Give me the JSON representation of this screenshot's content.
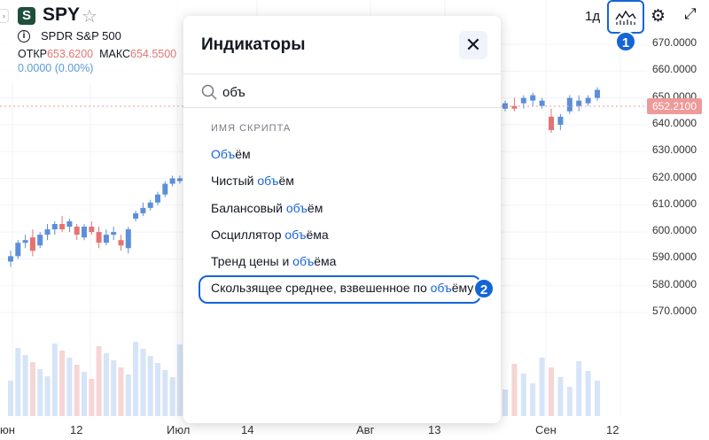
{
  "header": {
    "ticker": "SPY",
    "full_name": "SPDR S&P 500",
    "open_label": "ОТКР",
    "open_value": "653.6200",
    "high_label": "МАКС",
    "high_value": "654.5500",
    "change": "0.0000 (0.00%)"
  },
  "toolbar": {
    "timeframe": "1д",
    "indicators_icon": "indicators-icon",
    "settings_icon": "gear-icon",
    "expand_icon": "expand-icon"
  },
  "annotations": {
    "badge_1": "1",
    "badge_2": "2"
  },
  "modal": {
    "title": "Индикаторы",
    "search_value": "объ",
    "section_label": "ИМЯ СКРИПТА",
    "items": [
      {
        "pre": "",
        "hl": "Объ",
        "post": "ём"
      },
      {
        "pre": "Чистый ",
        "hl": "объ",
        "post": "ём"
      },
      {
        "pre": "Балансовый ",
        "hl": "объ",
        "post": "ём"
      },
      {
        "pre": "Осциллятор ",
        "hl": "объ",
        "post": "ёма"
      },
      {
        "pre": "Тренд цены и ",
        "hl": "объ",
        "post": "ёма"
      },
      {
        "pre": "Скользящее среднее, взвешенное по ",
        "hl": "объ",
        "post": "ёму"
      }
    ]
  },
  "price_axis": {
    "labels": [
      "670.0000",
      "660.0000",
      "650.0000",
      "640.0000",
      "630.0000",
      "620.0000",
      "610.0000",
      "600.0000",
      "590.0000",
      "580.0000",
      "570.0000"
    ],
    "current_price": "652.2100"
  },
  "time_axis": {
    "labels": [
      "юн",
      "12",
      "Июл",
      "14",
      "Авг",
      "13",
      "Сен",
      "12"
    ]
  },
  "colors": {
    "up": "#5b8fd9",
    "down": "#e57373",
    "accent": "#1565d8"
  },
  "chart_data": {
    "type": "candlestick",
    "ylim": [
      565,
      675
    ],
    "candles": [
      [
        589,
        593,
        587,
        591
      ],
      [
        591,
        597,
        590,
        596
      ],
      [
        596,
        599,
        594,
        597
      ],
      [
        598,
        601,
        591,
        593
      ],
      [
        595,
        600,
        594,
        599
      ],
      [
        599,
        603,
        597,
        601
      ],
      [
        601,
        604,
        599,
        603
      ],
      [
        603,
        606,
        600,
        601
      ],
      [
        602,
        605,
        600,
        604
      ],
      [
        602,
        603,
        597,
        599
      ],
      [
        598,
        603,
        597,
        602
      ],
      [
        602,
        604,
        599,
        600
      ],
      [
        600,
        602,
        594,
        596
      ],
      [
        596,
        601,
        595,
        599
      ],
      [
        599,
        602,
        597,
        600
      ],
      [
        597,
        599,
        593,
        595
      ],
      [
        594,
        602,
        592,
        601
      ],
      [
        605,
        608,
        604,
        607
      ],
      [
        607,
        611,
        606,
        609
      ],
      [
        609,
        612,
        608,
        611
      ],
      [
        611,
        615,
        610,
        614
      ],
      [
        614,
        619,
        613,
        618
      ],
      [
        618,
        621,
        617,
        620
      ],
      [
        619,
        621,
        618,
        620
      ]
    ]
  }
}
